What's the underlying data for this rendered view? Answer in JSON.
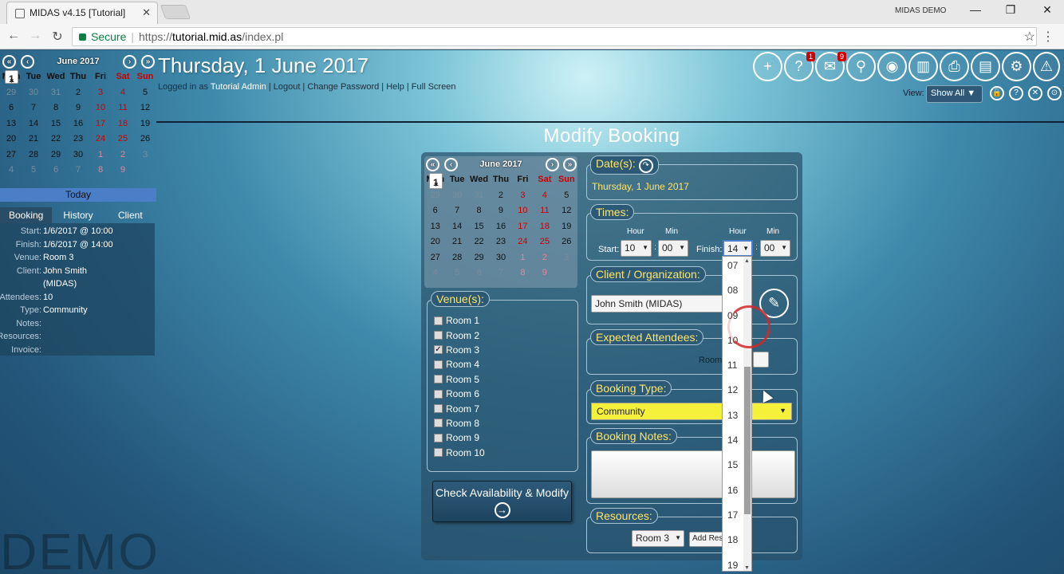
{
  "browser": {
    "tab_title": "MIDAS v4.15 [Tutorial]",
    "window_label": "MIDAS DEMO",
    "secure_label": "Secure",
    "url_scheme": "https://",
    "url_host": "tutorial.mid.as",
    "url_path": "/index.pl"
  },
  "sidebar": {
    "calendar": {
      "month": "June 2017",
      "dow": [
        "Mon",
        "Tue",
        "Wed",
        "Thu",
        "Fri",
        "Sat",
        "Sun"
      ],
      "weeks": [
        [
          "29",
          "30",
          "31",
          "1",
          "2",
          "3",
          "4"
        ],
        [
          "5",
          "6",
          "7",
          "8",
          "9",
          "10",
          "11"
        ],
        [
          "12",
          "13",
          "14",
          "15",
          "16",
          "17",
          "18"
        ],
        [
          "19",
          "20",
          "21",
          "22",
          "23",
          "24",
          "25"
        ],
        [
          "26",
          "27",
          "28",
          "29",
          "30",
          "1",
          "2"
        ],
        [
          "3",
          "4",
          "5",
          "6",
          "7",
          "8",
          "9"
        ]
      ]
    },
    "today_label": "Today",
    "tabs": [
      "Booking",
      "History",
      "Client"
    ],
    "summary": [
      {
        "label": "Start:",
        "value": "1/6/2017 @ 10:00"
      },
      {
        "label": "Finish:",
        "value": "1/6/2017 @ 14:00"
      },
      {
        "label": "Venue:",
        "value": "Room 3"
      },
      {
        "label": "Client:",
        "value": "John Smith"
      },
      {
        "label": "",
        "value": "(MIDAS)"
      },
      {
        "label": "Attendees:",
        "value": "10"
      },
      {
        "label": "Type:",
        "value": "Community"
      },
      {
        "label": "Notes:",
        "value": ""
      },
      {
        "label": "Resources:",
        "value": ""
      },
      {
        "label": "Invoice:",
        "value": ""
      }
    ],
    "watermark": "DEMO"
  },
  "header": {
    "title": "Thursday, 1 June 2017",
    "logged_in_prefix": "Logged in as ",
    "user": "Tutorial Admin",
    "links": " | Logout | Change Password | Help | Full Screen",
    "view_label": "View:",
    "view_value": "Show All",
    "badges": {
      "help": "1",
      "mail": "9"
    }
  },
  "form": {
    "title": "Modify Booking",
    "calendar": {
      "month": "June 2017"
    },
    "venues_label": "Venue(s):",
    "venues": [
      "Room 1",
      "Room 2",
      "Room 3",
      "Room 4",
      "Room 5",
      "Room 6",
      "Room 7",
      "Room 8",
      "Room 9",
      "Room 10"
    ],
    "checked_venue": "Room 3",
    "check_button": "Check Availability & Modify",
    "dates_label": "Date(s):",
    "date_value": "Thursday, 1 June 2017",
    "times_label": "Times:",
    "hour_label": "Hour",
    "min_label": "Min",
    "start_label": "Start:",
    "finish_label": "Finish:",
    "start_hour": "10",
    "start_min": "00",
    "finish_hour": "14",
    "finish_min": "00",
    "client_label": "Client / Organization:",
    "client_value": "John Smith (MIDAS)",
    "attendees_label": "Expected Attendees:",
    "attendees_prefix": "Room",
    "type_label": "Booking Type:",
    "type_value": "Community",
    "notes_label": "Booking Notes:",
    "resources_label": "Resources:",
    "resource_room": "Room 3",
    "add_res": "Add Res"
  },
  "hour_dropdown": [
    "07",
    "08",
    "09",
    "10",
    "11",
    "12",
    "13",
    "14",
    "15",
    "16",
    "17",
    "18",
    "19"
  ]
}
